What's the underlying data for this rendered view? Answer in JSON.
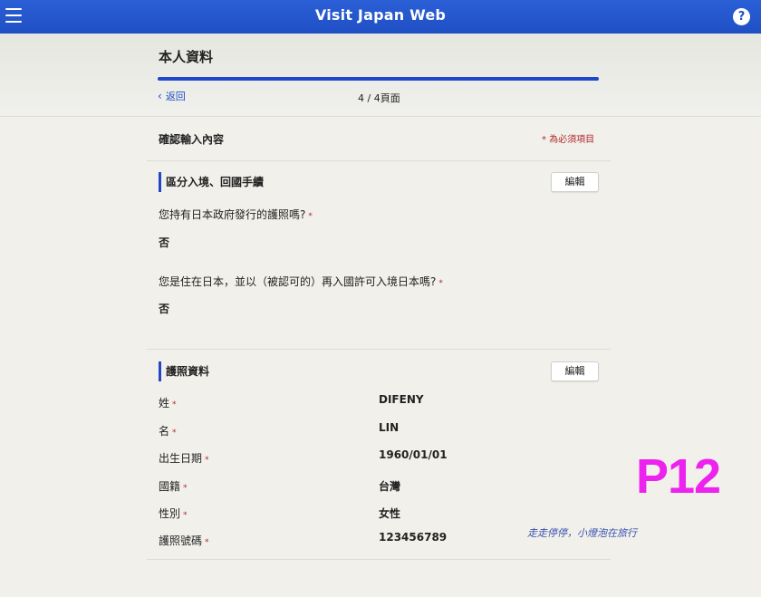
{
  "app": {
    "title": "Visit Japan Web",
    "help": "?"
  },
  "header": {
    "page_title": "本人資料",
    "back_label": "返回",
    "page_counter": "4 / 4頁面",
    "progress": 1.0
  },
  "confirm": {
    "heading": "確認輸入內容",
    "required_note": "* 為必須項目"
  },
  "section_entry": {
    "title": "區分入境、回國手續",
    "edit_label": "編輯",
    "q1": "您持有日本政府發行的護照嗎?",
    "a1": "否",
    "q2": "您是住在日本，並以（被認可的）再入國許可入境日本嗎?",
    "a2": "否"
  },
  "section_passport": {
    "title": "護照資料",
    "edit_label": "編輯",
    "fields": [
      {
        "label": "姓",
        "value": "DIFENY"
      },
      {
        "label": "名",
        "value": "LIN"
      },
      {
        "label": "出生日期",
        "value": "1960/01/01"
      },
      {
        "label": "國籍",
        "value": "台灣"
      },
      {
        "label": "性別",
        "value": "女性"
      },
      {
        "label": "護照號碼",
        "value": "123456789"
      }
    ]
  },
  "required_mark": "*",
  "overlay": {
    "page_tag": "P12",
    "signature": "走走停停，小燈泡在旅行"
  },
  "colors": {
    "brand_blue": "#1f4fc4",
    "required_red": "#b3262a",
    "tag_magenta": "#ee22ee"
  },
  "icons": {
    "menu": "hamburger-icon",
    "help": "help-icon",
    "back": "chevron-left-icon"
  }
}
